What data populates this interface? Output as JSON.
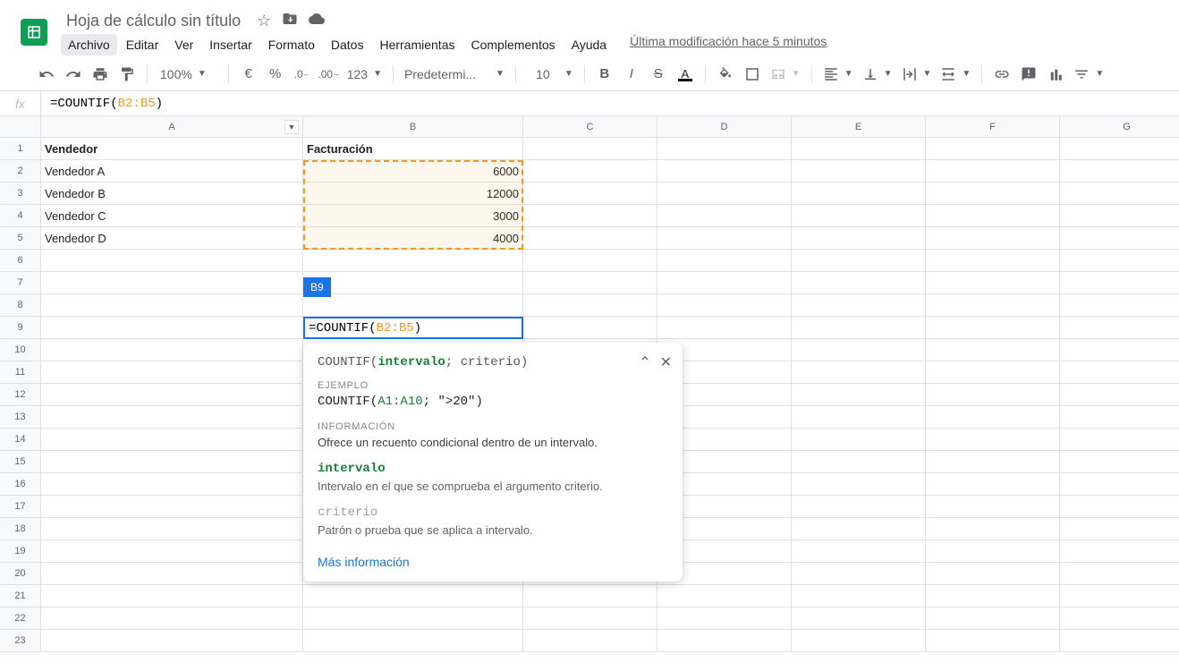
{
  "header": {
    "title": "Hoja de cálculo sin título",
    "menus": [
      "Archivo",
      "Editar",
      "Ver",
      "Insertar",
      "Formato",
      "Datos",
      "Herramientas",
      "Complementos",
      "Ayuda"
    ],
    "last_modified": "Última modificación hace 5 minutos"
  },
  "toolbar": {
    "zoom": "100%",
    "number_format": "123",
    "font": "Predetermi...",
    "font_size": "10"
  },
  "formula": {
    "prefix": "=COUNTIF(",
    "range": "B2:B5",
    "suffix": ")"
  },
  "columns": [
    "A",
    "B",
    "C",
    "D",
    "E",
    "F",
    "G"
  ],
  "rows": [
    "1",
    "2",
    "3",
    "4",
    "5",
    "6",
    "7",
    "8",
    "9",
    "10",
    "11",
    "12",
    "13",
    "14",
    "15",
    "16",
    "17",
    "18",
    "19",
    "20",
    "21",
    "22",
    "23"
  ],
  "data": {
    "A1": "Vendedor",
    "B1": "Facturación",
    "A2": "Vendedor A",
    "B2": "6000",
    "A3": "Vendedor B",
    "B3": "12000",
    "A4": "Vendedor C",
    "B4": "3000",
    "A5": "Vendedor D",
    "B5": "4000"
  },
  "active": {
    "label": "B9",
    "prefix": "=COUNTIF(",
    "range": "B2:B5",
    "suffix": ")"
  },
  "helper": {
    "sig_fn": "COUNTIF(",
    "sig_arg1": "intervalo",
    "sig_rest": "; criterio)",
    "ex_label": "EJEMPLO",
    "ex_fn": "COUNTIF(",
    "ex_range": "A1:A10",
    "ex_rest": "; \">20\")",
    "info_label": "INFORMACIÓN",
    "info_text": "Ofrece un recuento condicional dentro de un intervalo.",
    "arg1_name": "intervalo",
    "arg1_desc": "Intervalo en el que se comprueba el argumento criterio.",
    "arg2_name": "criterio",
    "arg2_desc": "Patrón o prueba que se aplica a intervalo.",
    "link": "Más información"
  }
}
